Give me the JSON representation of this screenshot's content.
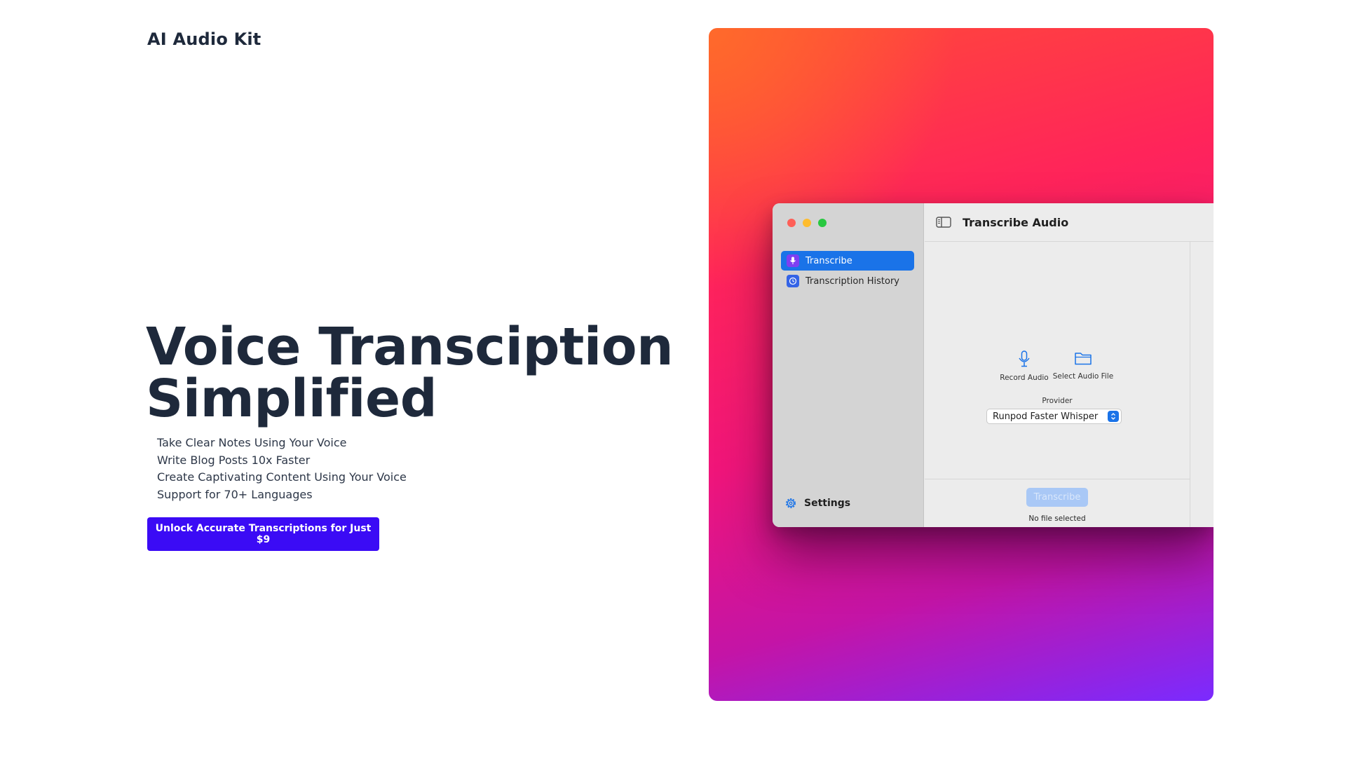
{
  "brand": {
    "name": "AI Audio Kit"
  },
  "hero": {
    "title_line1": "Voice Transciption",
    "title_line2": "Simplified",
    "features": [
      "Take Clear Notes Using Your Voice",
      "Write Blog Posts 10x Faster",
      "Create Captivating Content Using Your Voice",
      "Support for 70+ Languages"
    ],
    "cta_label": "Unlock Accurate Transcriptions for Just $9"
  },
  "app": {
    "window_title": "Transcribe Audio",
    "sidebar": {
      "items": [
        {
          "label": "Transcribe",
          "icon": "microphone-icon",
          "active": true
        },
        {
          "label": "Transcription History",
          "icon": "clock-icon",
          "active": false
        }
      ],
      "settings_label": "Settings"
    },
    "actions": {
      "record_label": "Record Audio",
      "select_label": "Select Audio File"
    },
    "provider": {
      "label": "Provider",
      "selected": "Runpod Faster Whisper"
    },
    "transcribe_button": "Transcribe",
    "status": "No file selected"
  },
  "colors": {
    "cta": "#3b0bf5",
    "accent_blue": "#1a73e8",
    "gradient_start": "#ff6a2b",
    "gradient_mid": "#f0157a",
    "gradient_end": "#7a2bff"
  }
}
